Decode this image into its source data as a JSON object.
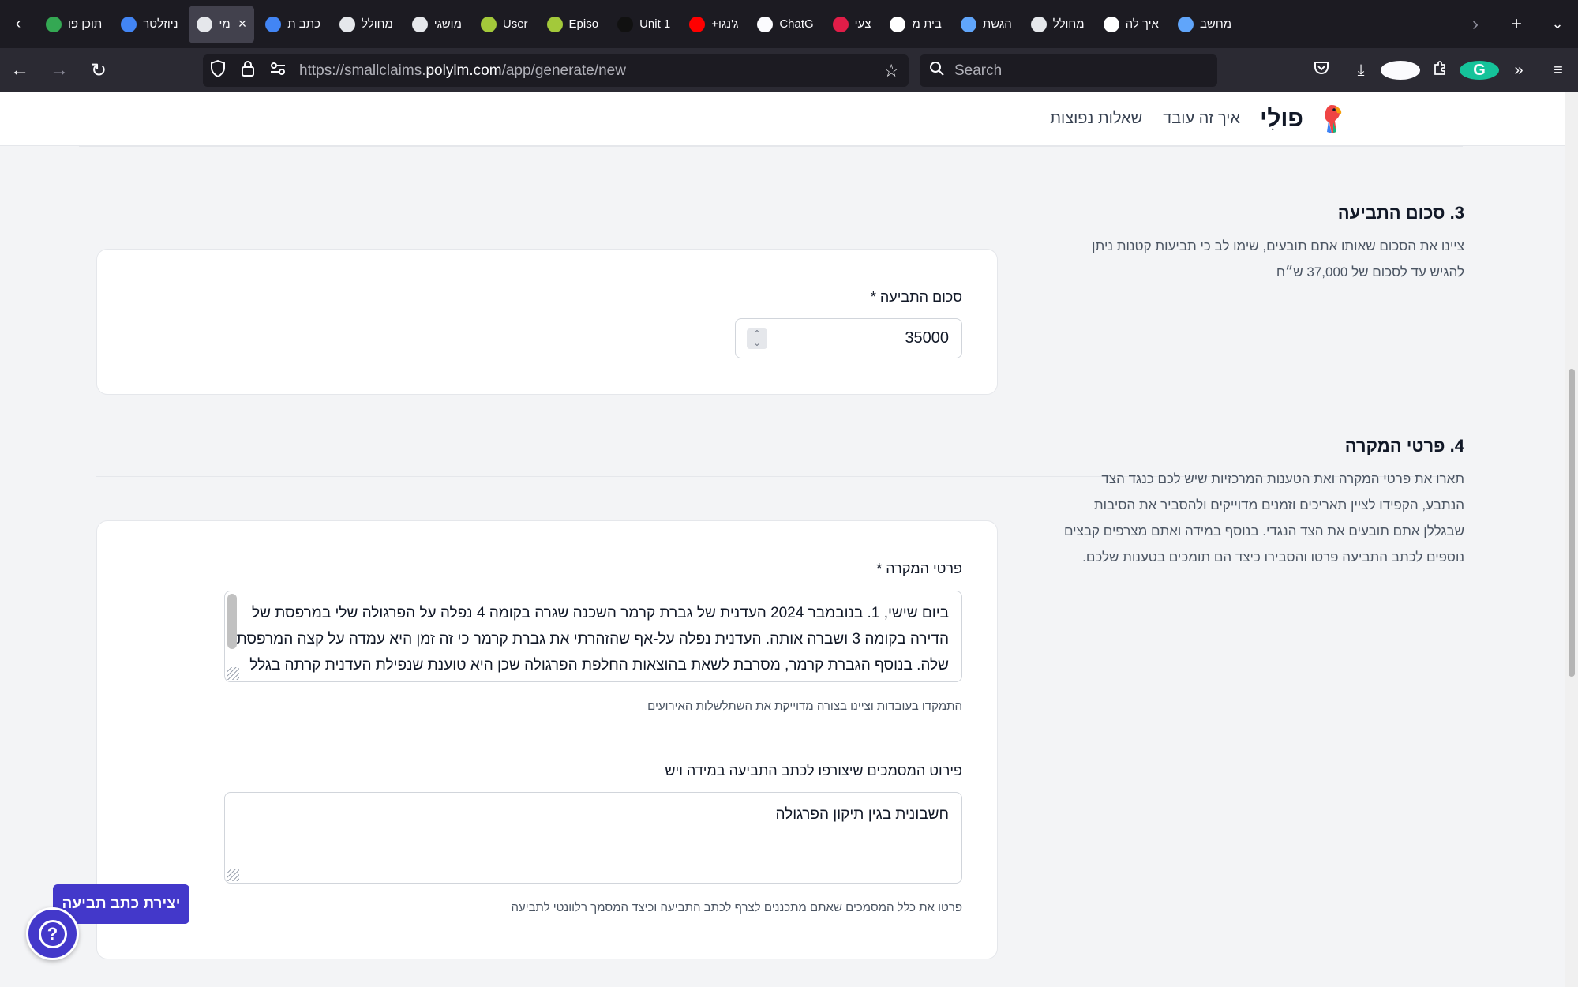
{
  "browser": {
    "tabs": [
      {
        "title": "תוכן פו",
        "icon": "sheets-icon",
        "color": "#34a853"
      },
      {
        "title": "ניוזלטר",
        "icon": "docs-icon",
        "color": "#4285f4"
      },
      {
        "title": "מי",
        "icon": "polly-icon",
        "color": "#e5e7eb",
        "active": true
      },
      {
        "title": "כתב ת",
        "icon": "docs-icon",
        "color": "#4285f4"
      },
      {
        "title": "מחולל",
        "icon": "polly-icon",
        "color": "#e5e7eb"
      },
      {
        "title": "מושגי",
        "icon": "polly-icon",
        "color": "#e5e7eb"
      },
      {
        "title": "User",
        "icon": "wifi-icon",
        "color": "#a3c93a"
      },
      {
        "title": "Episo",
        "icon": "wifi-icon",
        "color": "#a3c93a"
      },
      {
        "title": "Unit 1",
        "icon": "book-icon",
        "color": "#111111"
      },
      {
        "title": "ג'נגו+",
        "icon": "youtube-icon",
        "color": "#ff0000"
      },
      {
        "title": "ChatG",
        "icon": "openai-icon",
        "color": "#fbfbfe"
      },
      {
        "title": "צעי",
        "icon": "bolt-icon",
        "color": "#e11d48"
      },
      {
        "title": "בית מ",
        "icon": "google-icon",
        "color": "#ffffff"
      },
      {
        "title": "הגשת",
        "icon": "check-icon",
        "color": "#60a5fa"
      },
      {
        "title": "מחולל",
        "icon": "polly-icon",
        "color": "#e5e7eb"
      },
      {
        "title": "איך לה",
        "icon": "google-icon",
        "color": "#ffffff"
      },
      {
        "title": "מחשב",
        "icon": "cog-icon",
        "color": "#60a5fa"
      }
    ],
    "url_prefix": "https://smallclaims.",
    "url_domain": "polylm.com",
    "url_path": "/app/generate/new",
    "search_placeholder": "Search"
  },
  "site": {
    "brand": "פולִי",
    "nav": [
      "איך זה עובד",
      "שאלות נפוצות"
    ]
  },
  "section3": {
    "title": "3. סכום התביעה",
    "desc_line1": "ציינו את הסכום שאותו אתם תובעים, שימו לב כי תביעות קטנות ניתן",
    "desc_line2": "להגיש עד לסכום של 37,000 ש״ח",
    "amount_label": "סכום התביעה *",
    "amount_value": "35000"
  },
  "section4": {
    "title": "4. פרטי המקרה",
    "desc_lines": [
      "תארו את פרטי המקרה ואת הטענות המרכזיות שיש לכם כנגד הצד",
      "הנתבע, הקפידו לציין תאריכים וזמנים מדוייקים ולהסביר את הסיבות",
      "שבגללן אתם תובעים את הצד הנגדי. בנוסף במידה ואתם מצרפים קבצים",
      "נוספים לכתב התביעה פרטו והסבירו כיצד הם תומכים בטענות שלכם."
    ],
    "details_label": "פרטי המקרה *",
    "details_lines": [
      "ביום שישי, 1. בנובמבר 2024 העדנית של גברת קרמר השכנה שגרה בקומה 4 נפלה על הפרגולה שלי במרפסת של",
      "הדירה בקומה 3 ושברה אותה. העדנית נפלה על-אף שהזהרתי את גברת קרמר כי זה זמן היא עמדה על קצה המרפסת",
      "שלה. בנוסף הגברת קרמר, מסרבת לשאת בהוצאות החלפת הפרגולה שכן היא טוענת שנפילת העדנית קרתה בגלל"
    ],
    "details_hint": "התמקדו בעובדות וציינו בצורה מדוייקת את השתלשלות האירועים",
    "docs_label": "פירוט המסמכים שיצורפו לכתב התביעה במידה ויש",
    "docs_value": "חשבונית בגין תיקון הפרגולה",
    "docs_hint": "פרטו את כלל המסמכים שאתם מתכננים לצרף לכתב התביעה וכיצד המסמך רלוונטי לתביעה"
  },
  "submit_label": "יצירת כתב תביעה",
  "help_label": "?"
}
